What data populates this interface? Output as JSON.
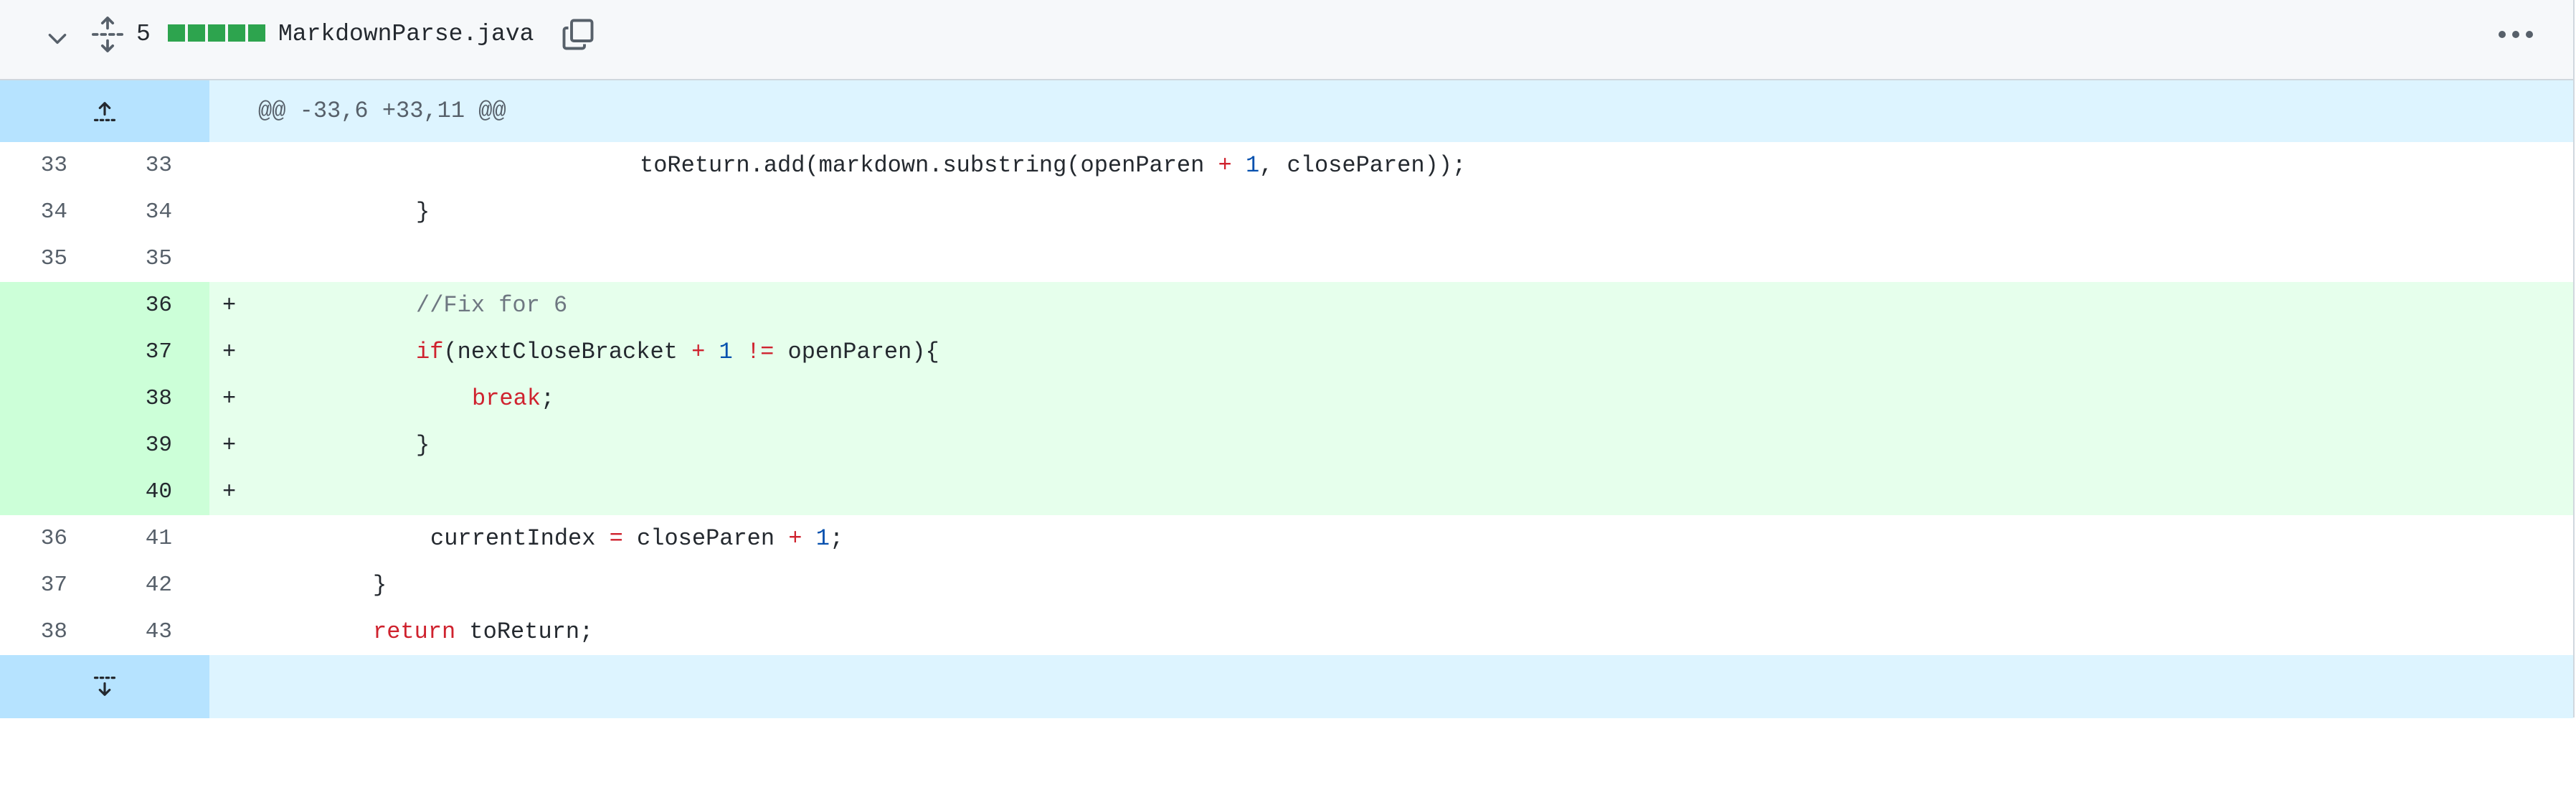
{
  "file": {
    "change_count": "5",
    "name": "MarkdownParse.java",
    "diffstat_color": "#2da44e",
    "icons": [
      "chevron-down-icon",
      "unfold-icon",
      "copy-icon",
      "kebab-horizontal-icon"
    ]
  },
  "hunk": {
    "header": "@@ -33,6 +33,11 @@",
    "expand_up_icon": "fold-up-icon",
    "expand_down_icon": "fold-down-icon"
  },
  "lines": [
    {
      "old": "33",
      "new": "33",
      "marker": "",
      "type": "context"
    },
    {
      "old": "34",
      "new": "34",
      "marker": "",
      "type": "context"
    },
    {
      "old": "35",
      "new": "35",
      "marker": "",
      "type": "context"
    },
    {
      "old": "",
      "new": "36",
      "marker": "+",
      "type": "add"
    },
    {
      "old": "",
      "new": "37",
      "marker": "+",
      "type": "add"
    },
    {
      "old": "",
      "new": "38",
      "marker": "+",
      "type": "add"
    },
    {
      "old": "",
      "new": "39",
      "marker": "+",
      "type": "add"
    },
    {
      "old": "",
      "new": "40",
      "marker": "+",
      "type": "add"
    },
    {
      "old": "36",
      "new": "41",
      "marker": "",
      "type": "context"
    },
    {
      "old": "37",
      "new": "42",
      "marker": "",
      "type": "context"
    },
    {
      "old": "38",
      "new": "43",
      "marker": "",
      "type": "context"
    }
  ],
  "code": {
    "l0": {
      "a": "toReturn",
      "b": ".add(markdown.substring(openParen ",
      "c": "+",
      "d": " ",
      "e": "1",
      "f": ", closeParen));"
    },
    "l1": {
      "a": "}"
    },
    "l3": {
      "a": "//Fix for 6"
    },
    "l4": {
      "a": "if",
      "b": "(nextCloseBracket ",
      "c": "+",
      "d": " ",
      "e": "1",
      "f": " ",
      "g": "!=",
      "h": " openParen){"
    },
    "l5": {
      "a": "break",
      "b": ";"
    },
    "l6": {
      "a": "}"
    },
    "l8": {
      "a": "currentIndex ",
      "b": "=",
      "c": " closeParen ",
      "d": "+",
      "e": " ",
      "f": "1",
      "g": ";"
    },
    "l9": {
      "a": "}"
    },
    "l10": {
      "a": "return",
      "b": " toReturn;"
    }
  },
  "colors": {
    "add_bg": "#e6ffec",
    "add_gutter_bg": "#ccffd8",
    "hunk_bg": "#ddf4ff",
    "expander_bg": "#b6e3ff",
    "keyword": "#cf222e",
    "number": "#0550ae",
    "comment": "#6e7781"
  }
}
